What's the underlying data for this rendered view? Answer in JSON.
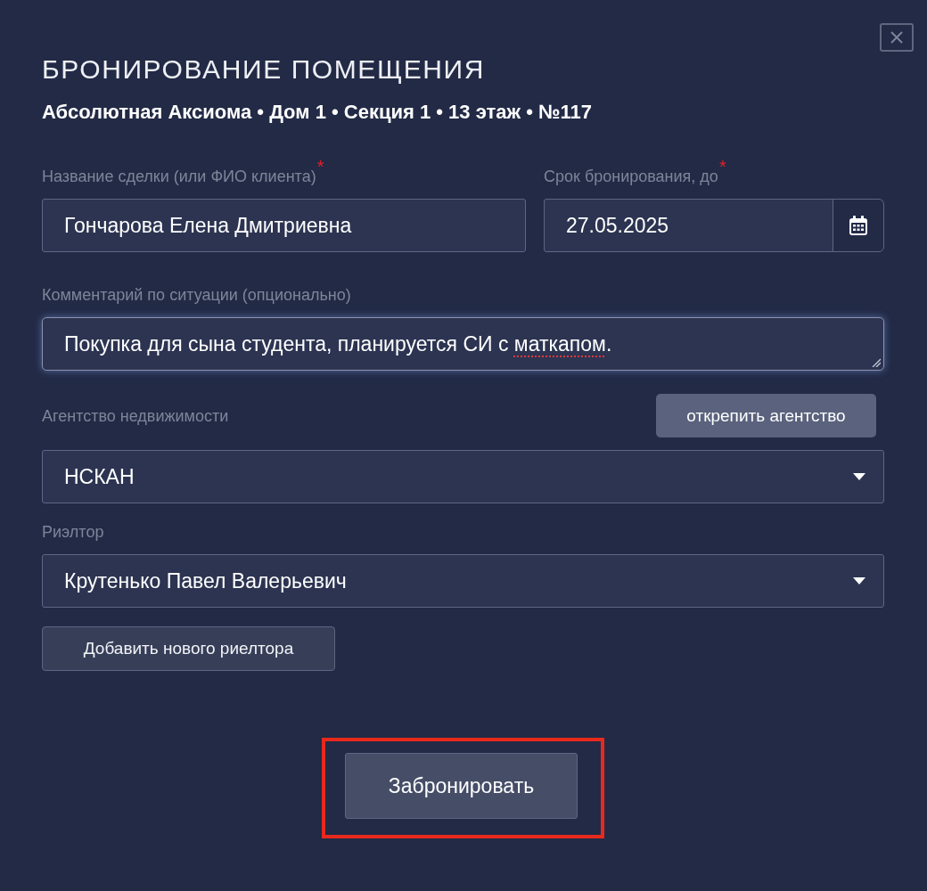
{
  "dialog": {
    "title": "БРОНИРОВАНИЕ ПОМЕЩЕНИЯ",
    "subtitle": "Абсолютная Аксиома • Дом 1 • Секция 1 • 13 этаж • №117"
  },
  "deal_name": {
    "label": "Название сделки (или ФИО клиента)",
    "required_mark": "*",
    "value": "Гончарова Елена Дмитриевна"
  },
  "booking_until": {
    "label": "Срок бронирования, до",
    "required_mark": "*",
    "value": "27.05.2025"
  },
  "comment": {
    "label": "Комментарий по ситуации (опционально)",
    "focused": true,
    "value_parts": [
      {
        "text": "Покупка для сына студента, планируется СИ с ",
        "misspelled": false
      },
      {
        "text": "маткапом",
        "misspelled": true
      },
      {
        "text": ".",
        "misspelled": false
      }
    ]
  },
  "agency": {
    "label": "Агентство недвижимости",
    "value": "НСКАН",
    "detach_button": "открепить агентство"
  },
  "realtor": {
    "label": "Риэлтор",
    "value": "Крутенько Павел Валерьевич"
  },
  "add_realtor_button": "Добавить нового риелтора",
  "submit_button": {
    "label": "Забронировать",
    "highlighted": true
  }
}
